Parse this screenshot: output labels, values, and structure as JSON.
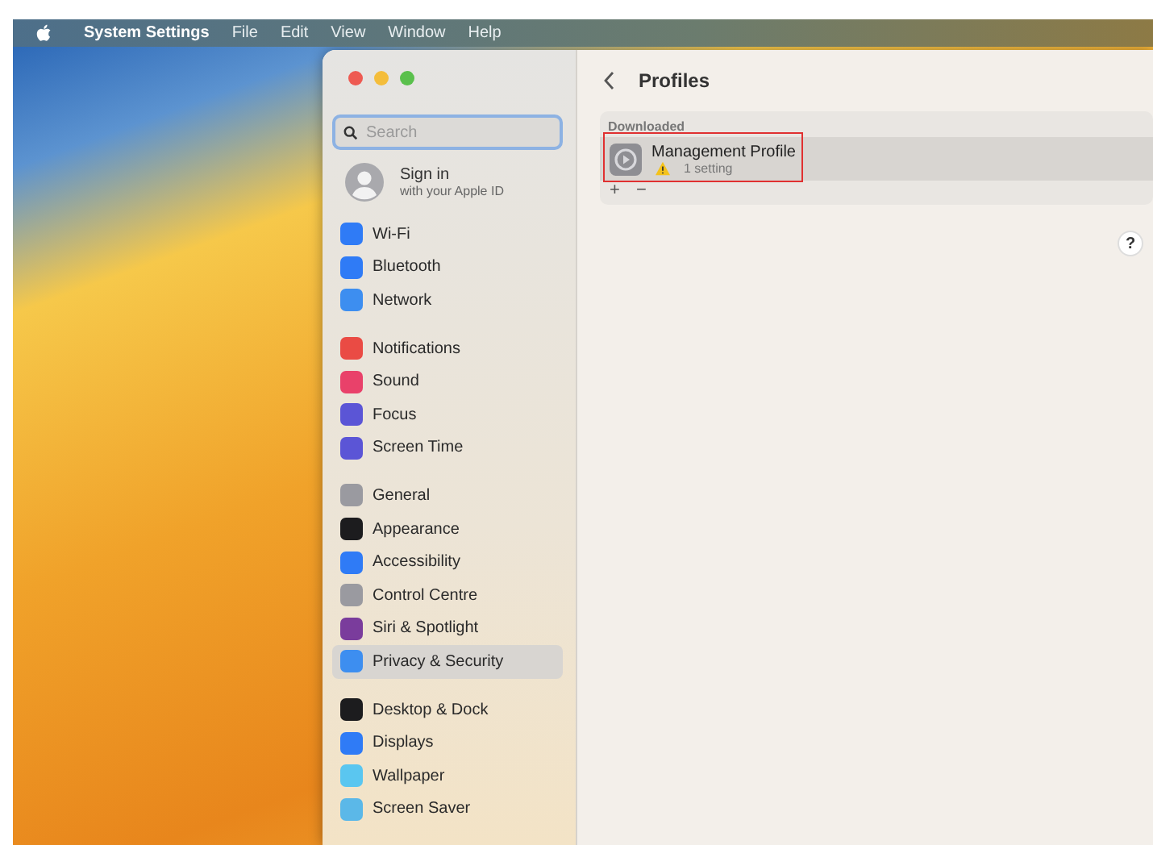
{
  "menu_bar": {
    "app_name": "System Settings",
    "menus": [
      "File",
      "Edit",
      "View",
      "Window",
      "Help"
    ]
  },
  "window": {
    "traffic_lights": [
      {
        "color": "#ee5a52"
      },
      {
        "color": "#f4bd3b"
      },
      {
        "color": "#5ac04c"
      }
    ]
  },
  "sidebar": {
    "search": {
      "placeholder": "Search"
    },
    "account": {
      "title": "Sign in",
      "subtitle": "with your Apple ID"
    },
    "groups": [
      [
        {
          "label": "Wi-Fi",
          "color": "#2f7bf6",
          "selected": false
        },
        {
          "label": "Bluetooth",
          "color": "#2f7bf6",
          "selected": false
        },
        {
          "label": "Network",
          "color": "#3d8ef0",
          "selected": false
        }
      ],
      [
        {
          "label": "Notifications",
          "color": "#ea4b44",
          "selected": false
        },
        {
          "label": "Sound",
          "color": "#e9416a",
          "selected": false
        },
        {
          "label": "Focus",
          "color": "#5b55d6",
          "selected": false
        },
        {
          "label": "Screen Time",
          "color": "#5b55d6",
          "selected": false
        }
      ],
      [
        {
          "label": "General",
          "color": "#9a9aa0",
          "selected": false
        },
        {
          "label": "Appearance",
          "color": "#1c1c1e",
          "selected": false
        },
        {
          "label": "Accessibility",
          "color": "#2f7bf6",
          "selected": false
        },
        {
          "label": "Control Centre",
          "color": "#9a9aa0",
          "selected": false
        },
        {
          "label": "Siri & Spotlight",
          "color": "#7a3c9c",
          "selected": false
        },
        {
          "label": "Privacy & Security",
          "color": "#3d8ef0",
          "selected": true
        }
      ],
      [
        {
          "label": "Desktop & Dock",
          "color": "#1c1c1e",
          "selected": false
        },
        {
          "label": "Displays",
          "color": "#2f7bf6",
          "selected": false
        },
        {
          "label": "Wallpaper",
          "color": "#5ac6f0",
          "selected": false
        },
        {
          "label": "Screen Saver",
          "color": "#5bb8e8",
          "selected": false
        }
      ]
    ]
  },
  "content": {
    "title": "Profiles",
    "section": {
      "heading": "Downloaded",
      "profiles": [
        {
          "name": "Management Profile",
          "detail": "1 setting",
          "warning": true,
          "selected": true,
          "highlighted": true
        }
      ],
      "add_label": "+",
      "remove_label": "−"
    },
    "help_label": "?"
  }
}
